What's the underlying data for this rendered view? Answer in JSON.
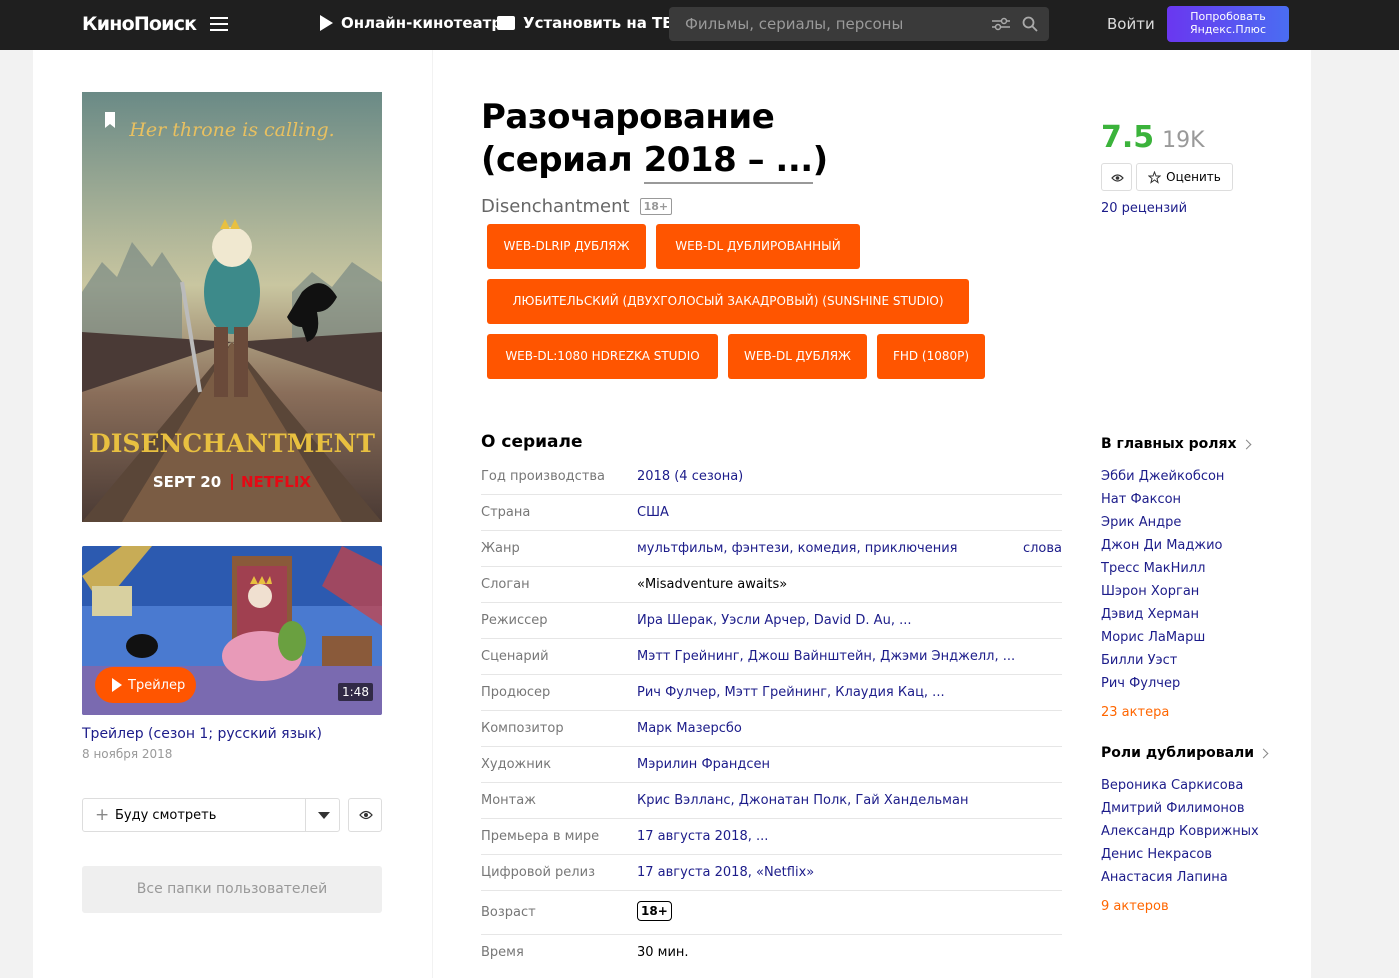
{
  "header": {
    "logo": "КиноПоиск",
    "nav": [
      "Онлайн-кинотеатр",
      "Установить на ТВ"
    ],
    "search_placeholder": "Фильмы, сериалы, персоны",
    "login": "Войти",
    "plus_line1": "Попробовать",
    "plus_line2": "Яндекс.Плюс"
  },
  "poster": {
    "tagline": "Her throne is calling.",
    "logo_text": "DISENCHANTMENT",
    "date_text": "SEPT 20",
    "brand": "NETFLIX"
  },
  "trailer": {
    "button": "Трейлер",
    "duration": "1:48",
    "title": "Трейлер (сезон 1; русский язык)",
    "date": "8 ноября 2018"
  },
  "actions": {
    "watch_later": "Буду смотреть",
    "folders": "Все папки пользователей"
  },
  "film": {
    "title_line1": "Разочарование",
    "title_prefix": "(сериал ",
    "title_year": "2018 – ...",
    "title_suffix": ")",
    "original": "Disenchantment",
    "age": "18+"
  },
  "tags": [
    "WEB-DLRIP ДУБЛЯЖ",
    "WEB-DL ДУБЛИРОВАННЫЙ",
    "ЛЮБИТЕЛЬСКИЙ (ДВУХГОЛОСЫЙ ЗАКАДРОВЫЙ) (SUNSHINE STUDIO)",
    "WEB-DL:1080 HDREZKA STUDIO",
    "WEB-DL ДУБЛЯЖ",
    "FHD (1080P)"
  ],
  "rating": {
    "value": "7.5",
    "count": "19K",
    "rate_label": "Оценить",
    "reviews": "20 рецензий"
  },
  "about": {
    "title": "О сериале",
    "rows": [
      {
        "label": "Год производства",
        "value": "2018 (4 сезона)"
      },
      {
        "label": "Страна",
        "value": "США"
      },
      {
        "label": "Жанр",
        "value": "мультфильм, фэнтези, комедия, приключения",
        "extra": "слова"
      },
      {
        "label": "Слоган",
        "value": "«Misadventure awaits»"
      },
      {
        "label": "Режиссер",
        "value": "Ира Шерак, Уэсли Арчер, David D. Au, ..."
      },
      {
        "label": "Сценарий",
        "value": "Мэтт Грейнинг, Джош Вайнштейн, Джэми Энджелл, ..."
      },
      {
        "label": "Продюсер",
        "value": "Рич Фулчер, Мэтт Грейнинг, Клаудия Кац, ..."
      },
      {
        "label": "Композитор",
        "value": "Марк Мазерсбо"
      },
      {
        "label": "Художник",
        "value": "Мэрилин Франдсен"
      },
      {
        "label": "Монтаж",
        "value": "Крис Вэлланс, Джонатан Полк, Гай Хандельман"
      },
      {
        "label": "Премьера в мире",
        "value": "17 августа 2018, ..."
      },
      {
        "label": "Цифровой релиз",
        "value": "17 августа 2018, «Netflix»"
      },
      {
        "label": "Возраст",
        "value": "18+"
      },
      {
        "label": "Время",
        "value": "30 мин."
      }
    ]
  },
  "cast": {
    "title": "В главных ролях",
    "actors": [
      "Эбби Джейкобсон",
      "Нат Факсон",
      "Эрик Андре",
      "Джон Ди Маджио",
      "Тресс МакНилл",
      "Шэрон Хорган",
      "Дэвид Херман",
      "Морис ЛаМарш",
      "Билли Уэст",
      "Рич Фулчер"
    ],
    "more": "23 актера"
  },
  "dubbing": {
    "title": "Роли дублировали",
    "actors": [
      "Вероника Саркисова",
      "Дмитрий Филимонов",
      "Александр Коврижных",
      "Денис Некрасов",
      "Анастасия Лапина"
    ],
    "more": "9 актеров"
  },
  "colors": {
    "accent": "#ff5500",
    "rating": "#3bb33b",
    "link": "#1c1c8a",
    "header_bg": "#1f1f1f"
  }
}
